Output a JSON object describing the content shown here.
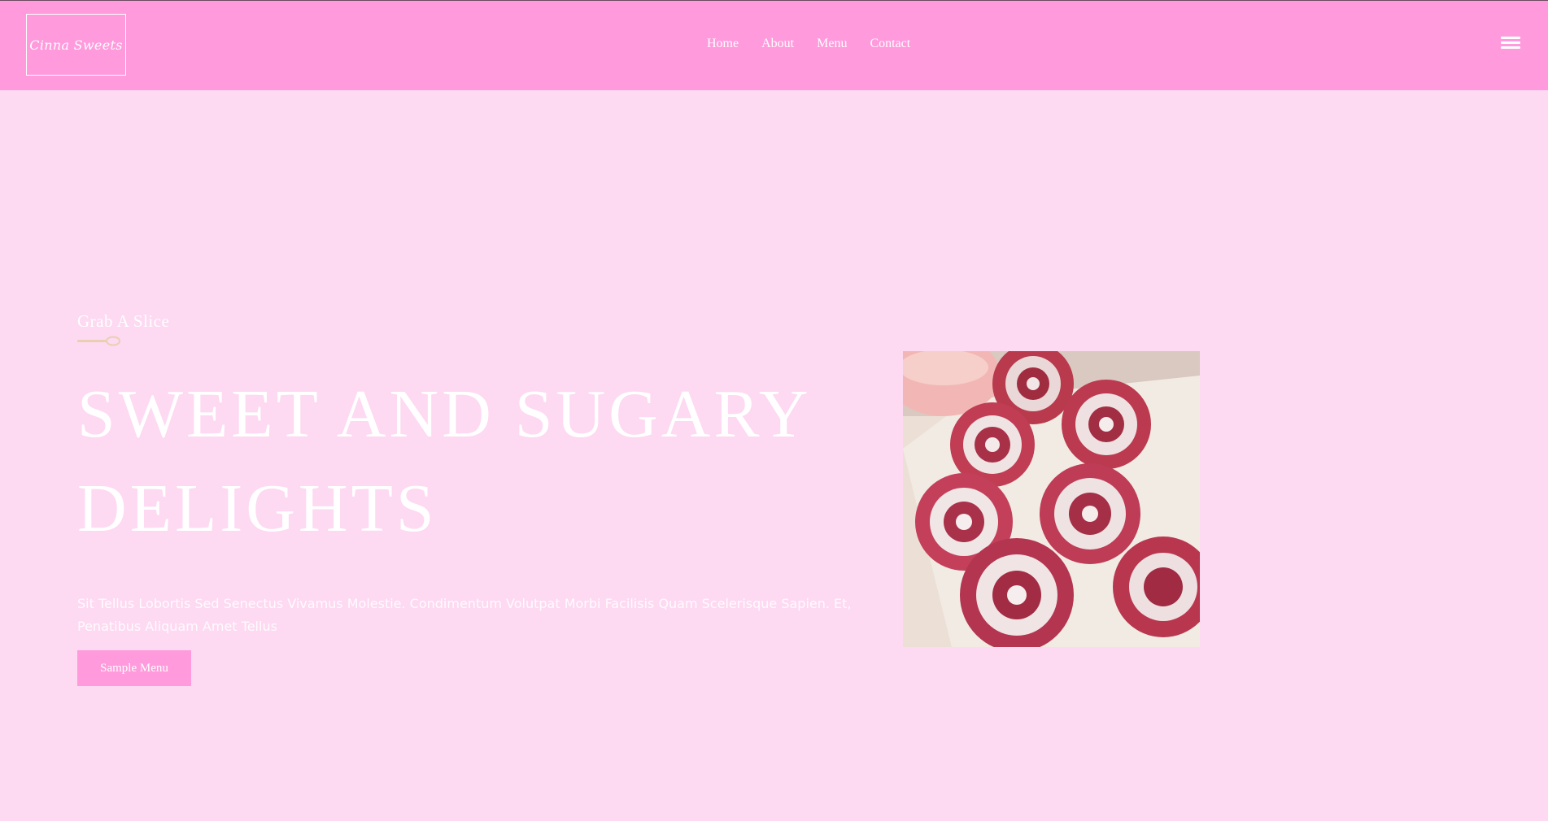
{
  "header": {
    "logo_text": "Cinna Sweets",
    "nav": [
      "Home",
      "About",
      "Menu",
      "Contact"
    ],
    "menu_icon": "hamburger-icon"
  },
  "hero": {
    "eyebrow": "Grab A Slice",
    "divider_icon": "spoon-icon",
    "title": "SWEET AND SUGARY DELIGHTS",
    "description": "Sit Tellus Lobortis Sed Senectus Vivamus Molestie. Condimentum Volutpat Morbi Facilisis Quam Scelerisque Sapien. Et, Penatibus Aliquam Amet Tellus",
    "button_label": "Sample Menu",
    "image": "cinnamon-rolls-photo"
  },
  "colors": {
    "header_bg": "#ff9adc",
    "page_bg": "#fdd9f2",
    "button_bg": "#ff9adc",
    "text": "#ffffff"
  }
}
